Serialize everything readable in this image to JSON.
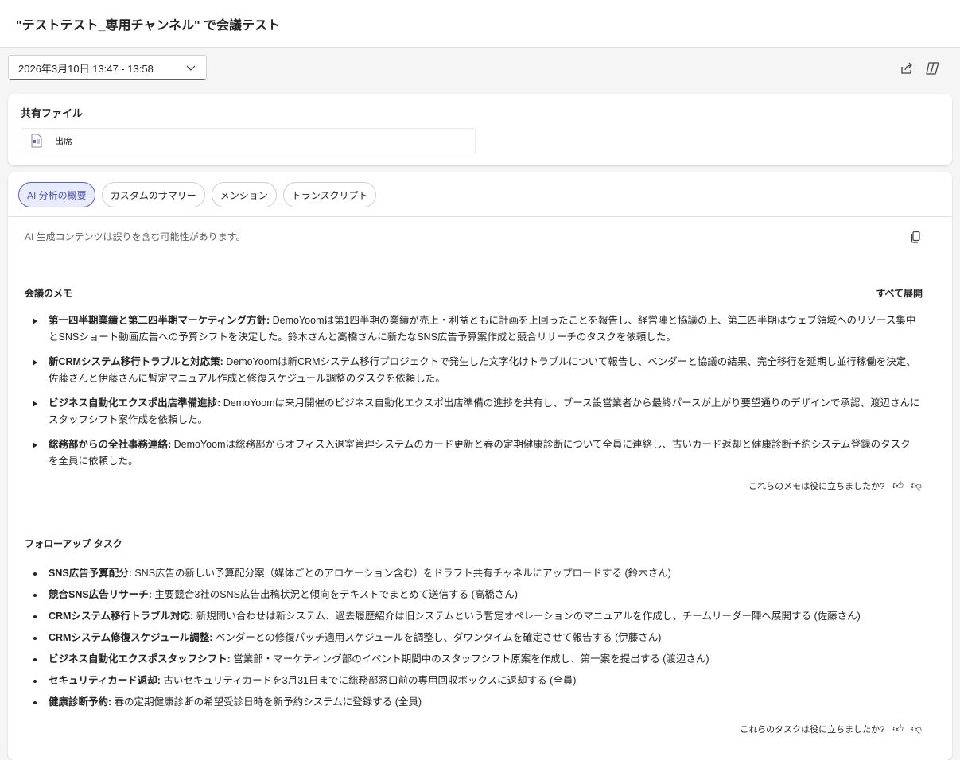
{
  "header": {
    "title": "\"テストテスト_専用チャンネル\" で会議テスト"
  },
  "toolbar": {
    "date_range": "2026年3月10日 13:47 - 13:58"
  },
  "shared_files": {
    "title": "共有ファイル",
    "files": [
      {
        "name": "出席"
      }
    ]
  },
  "tabs": [
    {
      "label": "AI 分析の概要"
    },
    {
      "label": "カスタムのサマリー"
    },
    {
      "label": "メンション"
    },
    {
      "label": "トランスクリプト"
    }
  ],
  "disclaimer": "AI 生成コンテンツは誤りを含む可能性があります。",
  "notes": {
    "title": "会議のメモ",
    "expand_all": "すべて展開",
    "items": [
      {
        "title": "第一四半期業績と第二四半期マーケティング方針:",
        "text": " DemoYoomは第1四半期の業績が売上・利益ともに計画を上回ったことを報告し、経営陣と協議の上、第二四半期はウェブ領域へのリソース集中とSNSショート動画広告への予算シフトを決定した。鈴木さんと高橋さんに新たなSNS広告予算案作成と競合リサーチのタスクを依頼した。"
      },
      {
        "title": "新CRMシステム移行トラブルと対応策:",
        "text": " DemoYoomは新CRMシステム移行プロジェクトで発生した文字化けトラブルについて報告し、ベンダーと協議の結果、完全移行を延期し並行稼働を決定、佐藤さんと伊藤さんに暫定マニュアル作成と修復スケジュール調整のタスクを依頼した。"
      },
      {
        "title": "ビジネス自動化エクスポ出店準備進捗:",
        "text": " DemoYoomは来月開催のビジネス自動化エクスポ出店準備の進捗を共有し、ブース設営業者から最終パースが上がり要望通りのデザインで承認、渡辺さんにスタッフシフト案作成を依頼した。"
      },
      {
        "title": "総務部からの全社事務連絡:",
        "text": " DemoYoomは総務部からオフィス入退室管理システムのカード更新と春の定期健康診断について全員に連絡し、古いカード返却と健康診断予約システム登録のタスクを全員に依頼した。"
      }
    ],
    "feedback": "これらのメモは役に立ちましたか?"
  },
  "tasks": {
    "title": "フォローアップ タスク",
    "items": [
      {
        "title": "SNS広告予算配分:",
        "text": " SNS広告の新しい予算配分案（媒体ごとのアロケーション含む）をドラフト共有チャネルにアップロードする (鈴木さん)"
      },
      {
        "title": "競合SNS広告リサーチ:",
        "text": " 主要競合3社のSNS広告出稿状況と傾向をテキストでまとめて送信する (高橋さん)"
      },
      {
        "title": "CRMシステム移行トラブル対応:",
        "text": " 新規問い合わせは新システム、過去履歴紹介は旧システムという暫定オペレーションのマニュアルを作成し、チームリーダー陣へ展開する (佐藤さん)"
      },
      {
        "title": "CRMシステム修復スケジュール調整:",
        "text": " ベンダーとの修復パッチ適用スケジュールを調整し、ダウンタイムを確定させて報告する (伊藤さん)"
      },
      {
        "title": "ビジネス自動化エクスポスタッフシフト:",
        "text": " 営業部・マーケティング部のイベント期間中のスタッフシフト原案を作成し、第一案を提出する (渡辺さん)"
      },
      {
        "title": "セキュリティカード返却:",
        "text": " 古いセキュリティカードを3月31日までに総務部窓口前の専用回収ボックスに返却する (全員)"
      },
      {
        "title": "健康診断予約:",
        "text": " 春の定期健康診断の希望受診日時を新予約システムに登録する (全員)"
      }
    ],
    "feedback": "これらのタスクは役に立ちましたか?"
  }
}
